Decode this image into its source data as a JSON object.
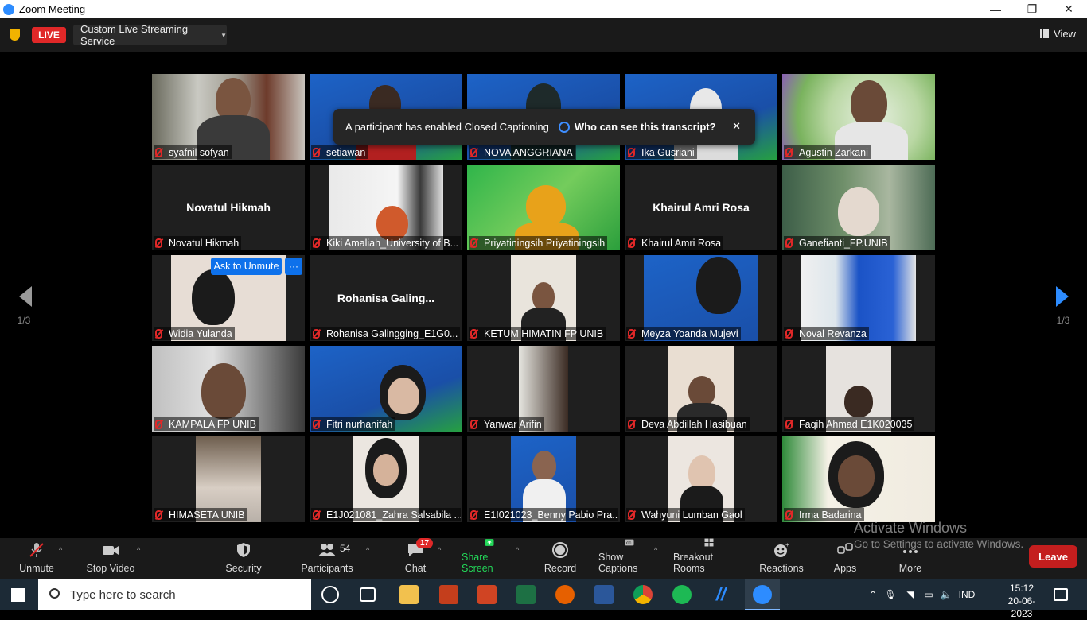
{
  "window": {
    "title": "Zoom Meeting",
    "controls": [
      "—",
      "❐",
      "✕"
    ]
  },
  "topbar": {
    "live_label": "LIVE",
    "stream_label": "Custom Live Streaming Service",
    "view_label": "View"
  },
  "caption_popup": {
    "message": "A participant has enabled Closed Captioning",
    "link": "Who can see this transcript?",
    "close": "✕"
  },
  "ask_unmute": {
    "label": "Ask to Unmute",
    "more": "···"
  },
  "pagination": {
    "left": "1/3",
    "right": "1/3"
  },
  "participants": [
    {
      "name": "syafnil sofyan"
    },
    {
      "name": "setiawan"
    },
    {
      "name": "NOVA ANGGRIANA",
      "active": true
    },
    {
      "name": "Ika Gusriani"
    },
    {
      "name": "Agustin Zarkani"
    },
    {
      "name": "Novatul Hikmah",
      "display_name": "Novatul Hikmah"
    },
    {
      "name": "Kiki Amaliah_University of B..."
    },
    {
      "name": "Priyatiningsih Priyatiningsih"
    },
    {
      "name": "Khairul Amri Rosa",
      "display_name": "Khairul Amri Rosa"
    },
    {
      "name": "Ganefianti_FP.UNIB"
    },
    {
      "name": "Widia Yulanda"
    },
    {
      "name": "Rohanisa Galingging_E1G0...",
      "display_name": "Rohanisa  Galing..."
    },
    {
      "name": "KETUM HIMATIN FP UNIB"
    },
    {
      "name": "Meyza Yoanda Mujevi"
    },
    {
      "name": "Noval Revanza"
    },
    {
      "name": "KAMPALA FP UNIB"
    },
    {
      "name": "Fitri nurhanifah"
    },
    {
      "name": "Yanwar Arifin"
    },
    {
      "name": "Deva Abdillah Hasibuan"
    },
    {
      "name": "Faqih Ahmad E1K020035"
    },
    {
      "name": "HIMASETA UNIB"
    },
    {
      "name": "E1J021081_Zahra Salsabila ..."
    },
    {
      "name": "E1I021023_Benny Pabio Pra..."
    },
    {
      "name": "Wahyuni Lumban Gaol"
    },
    {
      "name": "Irma Badarina"
    }
  ],
  "toolbar": {
    "unmute": "Unmute",
    "stop_video": "Stop Video",
    "security": "Security",
    "participants": "Participants",
    "participants_count": "54",
    "chat": "Chat",
    "chat_badge": "17",
    "share_screen": "Share Screen",
    "record": "Record",
    "show_captions": "Show Captions",
    "breakout_rooms": "Breakout Rooms",
    "reactions": "Reactions",
    "apps": "Apps",
    "more": "More",
    "leave": "Leave"
  },
  "watermark": {
    "line1": "Activate Windows",
    "line2": "Go to Settings to activate Windows."
  },
  "taskbar": {
    "search_placeholder": "Type here to search",
    "language": "IND",
    "time": "15:12",
    "date": "20-06-2023"
  },
  "colors": {
    "accent": "#2d8cff",
    "live_red": "#e02828",
    "share_green": "#23d959",
    "active_border": "#c8e06a",
    "leave_red": "#c41e1e"
  }
}
